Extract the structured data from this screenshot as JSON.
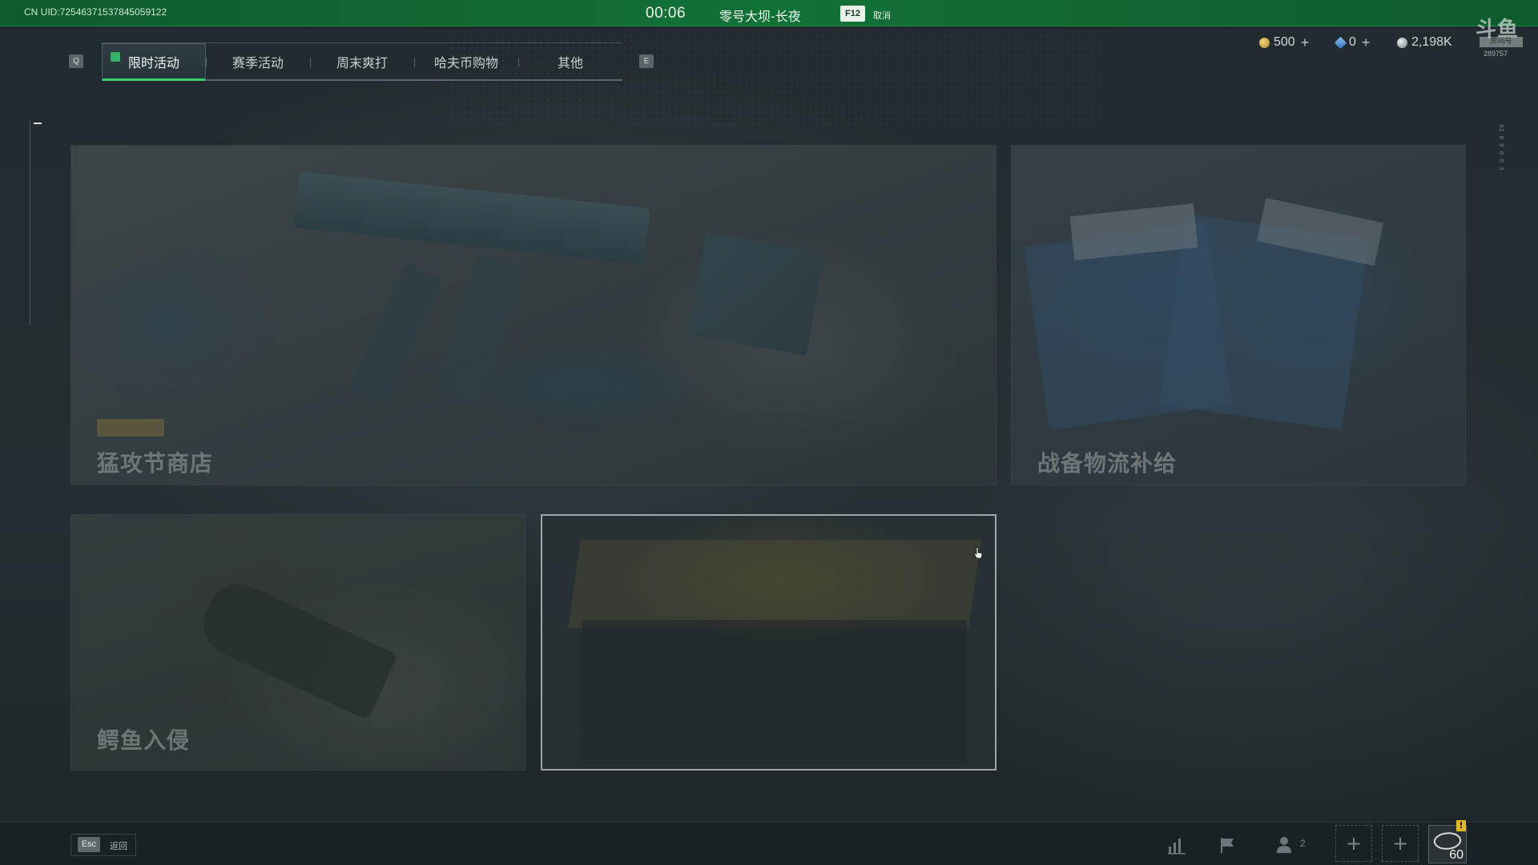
{
  "topbar": {
    "uid": "CN UID:7254637153784505912​2",
    "timer": "00:06",
    "map_name": "零号大坝-长夜",
    "cancel_key": "F12",
    "cancel_label": "取消"
  },
  "watermark": {
    "brand": "斗鱼",
    "sub": "房间号",
    "room_id": "289757"
  },
  "currencies": [
    {
      "icon": "coin-icon",
      "value": "500",
      "color": "#d9b44a"
    },
    {
      "icon": "ticket-icon",
      "value": "0",
      "color": "#4a8fd9"
    },
    {
      "icon": "havoc-coin-icon",
      "value": "2,198K",
      "color": "#b0b6b8"
    }
  ],
  "tabs": {
    "prev_key": "Q",
    "next_key": "E",
    "items": [
      {
        "label": "限时活动",
        "active": true
      },
      {
        "label": "赛季活动",
        "active": false
      },
      {
        "label": "周末爽打",
        "active": false
      },
      {
        "label": "哈夫币购物",
        "active": false
      },
      {
        "label": "其他",
        "active": false
      }
    ]
  },
  "cards": [
    {
      "title": "猛攻节商店"
    },
    {
      "title": "战备物流补给"
    },
    {
      "title": "鳄鱼入侵"
    },
    {
      "title": ""
    }
  ],
  "side_code": "61 8 8 6 0 3",
  "bottombar": {
    "esc_key": "Esc",
    "esc_label": "返回",
    "team_count": "2",
    "level": "60",
    "alert": "!"
  }
}
